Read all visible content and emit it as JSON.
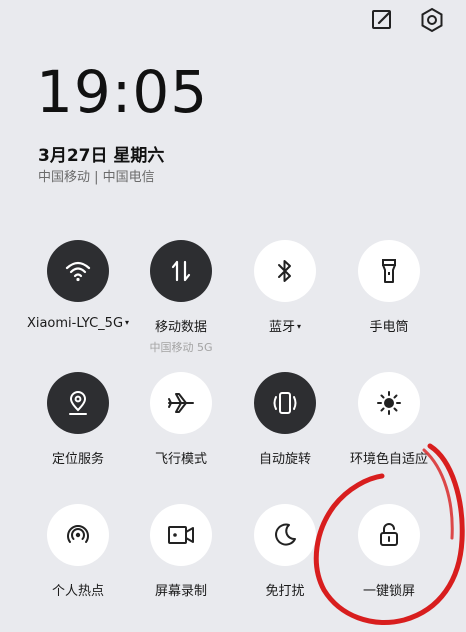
{
  "header": {
    "edit_icon": "edit-icon",
    "settings_icon": "gear-icon"
  },
  "status": {
    "time": "19:05",
    "date": "3月27日 星期六",
    "carrier": "中国移动 | 中国电信"
  },
  "tiles": [
    {
      "label": "Xiaomi-LYC_5G",
      "caret": "▾",
      "icon": "wifi-icon",
      "active": true
    },
    {
      "label": "移动数据",
      "sublabel": "中国移动 5G",
      "icon": "mobile-data-icon",
      "active": true
    },
    {
      "label": "蓝牙",
      "caret": "▾",
      "icon": "bluetooth-icon",
      "active": false
    },
    {
      "label": "手电筒",
      "icon": "flashlight-icon",
      "active": false
    },
    {
      "label": "定位服务",
      "icon": "location-icon",
      "active": true
    },
    {
      "label": "飞行模式",
      "icon": "airplane-icon",
      "active": false
    },
    {
      "label": "自动旋转",
      "icon": "rotate-icon",
      "active": true
    },
    {
      "label": "环境色自适应",
      "icon": "brightness-icon",
      "active": false
    },
    {
      "label": "个人热点",
      "icon": "hotspot-icon",
      "active": false
    },
    {
      "label": "屏幕录制",
      "icon": "screen-record-icon",
      "active": false
    },
    {
      "label": "免打扰",
      "icon": "moon-icon",
      "active": false
    },
    {
      "label": "一键锁屏",
      "icon": "lock-icon",
      "active": false
    }
  ],
  "colors": {
    "background": "#e9eaee",
    "active_tile": "#2d2e31",
    "inactive_tile": "#ffffff",
    "annotation": "#d81e1e"
  }
}
